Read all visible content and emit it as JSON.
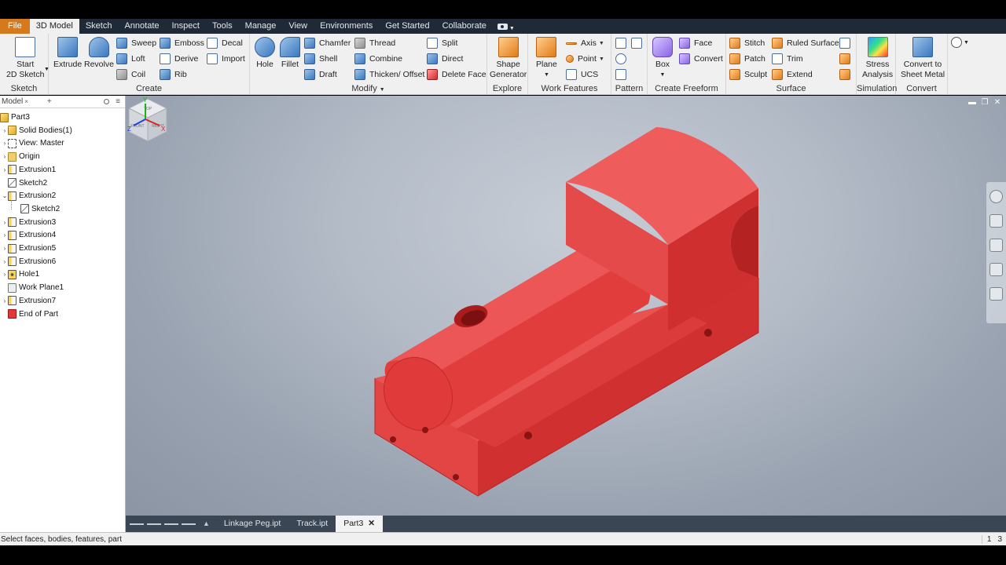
{
  "menu_tabs": [
    "File",
    "3D Model",
    "Sketch",
    "Annotate",
    "Inspect",
    "Tools",
    "Manage",
    "View",
    "Environments",
    "Get Started",
    "Collaborate"
  ],
  "active_tab": "3D Model",
  "ribbon": {
    "sketch_panel": {
      "title": "Sketch",
      "start_sketch": [
        "Start",
        "2D Sketch"
      ]
    },
    "create_panel": {
      "title": "Create",
      "extrude": "Extrude",
      "revolve": "Revolve",
      "sweep": "Sweep",
      "loft": "Loft",
      "coil": "Coil",
      "emboss": "Emboss",
      "derive": "Derive",
      "rib": "Rib",
      "decal": "Decal",
      "import": "Import"
    },
    "modify_panel": {
      "title": "Modify",
      "hole": "Hole",
      "fillet": "Fillet",
      "chamfer": "Chamfer",
      "shell": "Shell",
      "draft": "Draft",
      "thread": "Thread",
      "combine": "Combine",
      "thicken": "Thicken/ Offset",
      "split": "Split",
      "direct": "Direct",
      "delete_face": "Delete Face"
    },
    "explore_panel": {
      "title": "Explore",
      "shape_generator": [
        "Shape",
        "Generator"
      ]
    },
    "work_features_panel": {
      "title": "Work Features",
      "plane": "Plane",
      "axis": "Axis",
      "point": "Point",
      "ucs": "UCS"
    },
    "pattern_panel": {
      "title": "Pattern"
    },
    "freeform_panel": {
      "title": "Create Freeform",
      "box": "Box",
      "face": "Face",
      "convert": "Convert"
    },
    "surface_panel": {
      "title": "Surface",
      "stitch": "Stitch",
      "patch": "Patch",
      "sculpt": "Sculpt",
      "ruled_surface": "Ruled Surface",
      "trim": "Trim",
      "extend": "Extend"
    },
    "simulation_panel": {
      "title": "Simulation",
      "stress_analysis": [
        "Stress",
        "Analysis"
      ]
    },
    "convert_panel": {
      "title": "Convert",
      "sheet_metal": [
        "Convert to",
        "Sheet Metal"
      ]
    }
  },
  "browser": {
    "title": "Model",
    "items": [
      {
        "label": "Part3",
        "icon": "part-icon",
        "expander": "",
        "indent": 0
      },
      {
        "label": "Solid Bodies(1)",
        "icon": "solid-bodies-icon",
        "expander": "›",
        "indent": 1
      },
      {
        "label": "View: Master",
        "icon": "view-icon",
        "expander": "›",
        "indent": 1
      },
      {
        "label": "Origin",
        "icon": "folder-icon",
        "expander": "›",
        "indent": 1
      },
      {
        "label": "Extrusion1",
        "icon": "extrusion-icon",
        "expander": "›",
        "indent": 1
      },
      {
        "label": "Sketch2",
        "icon": "sketch-icon",
        "expander": "",
        "indent": 1
      },
      {
        "label": "Extrusion2",
        "icon": "extrusion-icon",
        "expander": "⌄",
        "indent": 1
      },
      {
        "label": "Sketch2",
        "icon": "sketch-icon",
        "expander": "",
        "indent": 2
      },
      {
        "label": "Extrusion3",
        "icon": "extrusion-icon",
        "expander": "›",
        "indent": 1
      },
      {
        "label": "Extrusion4",
        "icon": "extrusion-icon",
        "expander": "›",
        "indent": 1
      },
      {
        "label": "Extrusion5",
        "icon": "extrusion-icon",
        "expander": "›",
        "indent": 1
      },
      {
        "label": "Extrusion6",
        "icon": "extrusion-icon",
        "expander": "›",
        "indent": 1
      },
      {
        "label": "Hole1",
        "icon": "hole-icon",
        "expander": "›",
        "indent": 1
      },
      {
        "label": "Work Plane1",
        "icon": "work-plane-icon",
        "expander": "",
        "indent": 1
      },
      {
        "label": "Extrusion7",
        "icon": "extrusion-icon",
        "expander": "›",
        "indent": 1
      },
      {
        "label": "End of Part",
        "icon": "end-of-part-icon",
        "expander": "",
        "indent": 1
      }
    ]
  },
  "viewcube": {
    "top": "TOP",
    "front": "FRONT",
    "right": "RIGHT"
  },
  "triad": {
    "x": "X",
    "y": "Y",
    "z": "Z"
  },
  "doc_tabs": [
    {
      "label": "Linkage Peg.ipt",
      "active": false
    },
    {
      "label": "Track.ipt",
      "active": false
    },
    {
      "label": "Part3",
      "active": true
    }
  ],
  "status": {
    "message": "Select faces, bodies, features, part",
    "count_a": "1",
    "count_b": "3"
  },
  "colors": {
    "part_red": "#e03535",
    "file_tab": "#d57a1c",
    "tab_bar": "#1f2a36"
  }
}
